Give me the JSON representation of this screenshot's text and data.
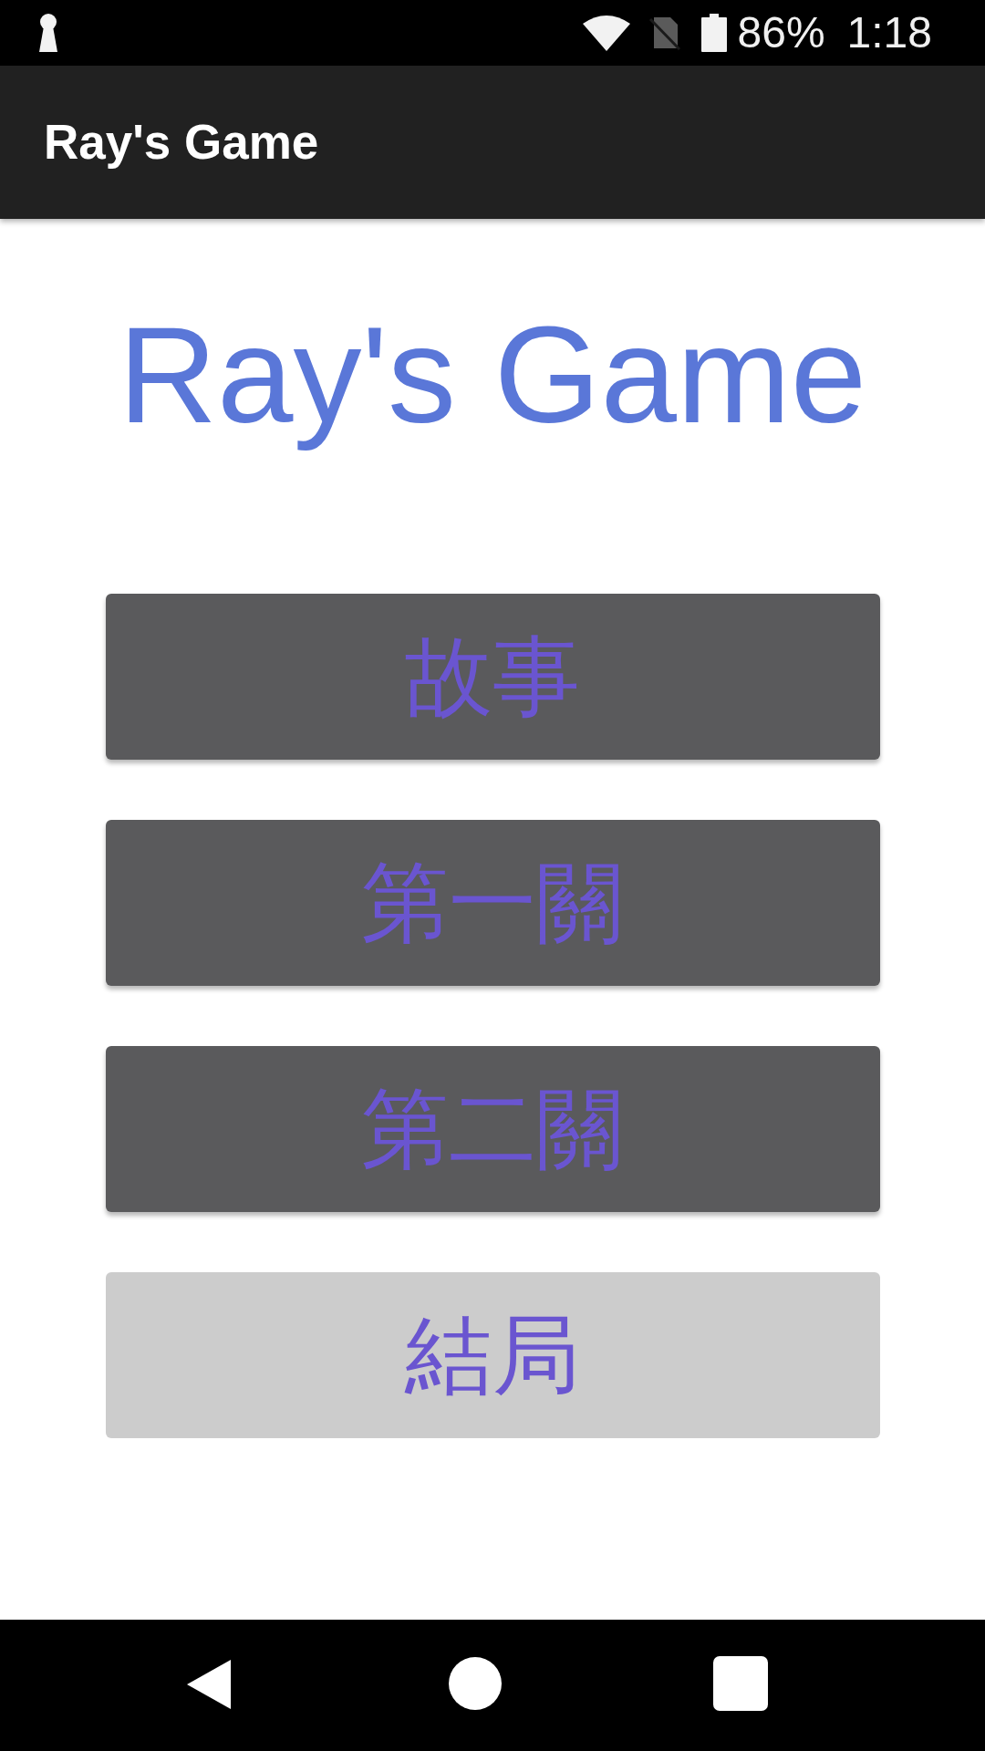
{
  "status_bar": {
    "battery": "86%",
    "time": "1:18"
  },
  "app_bar": {
    "title": "Ray's Game"
  },
  "heading": "Ray's Game",
  "menu_buttons": [
    {
      "label": "故事",
      "disabled": false
    },
    {
      "label": "第一關",
      "disabled": false
    },
    {
      "label": "第二關",
      "disabled": false
    },
    {
      "label": "結局",
      "disabled": true
    }
  ]
}
